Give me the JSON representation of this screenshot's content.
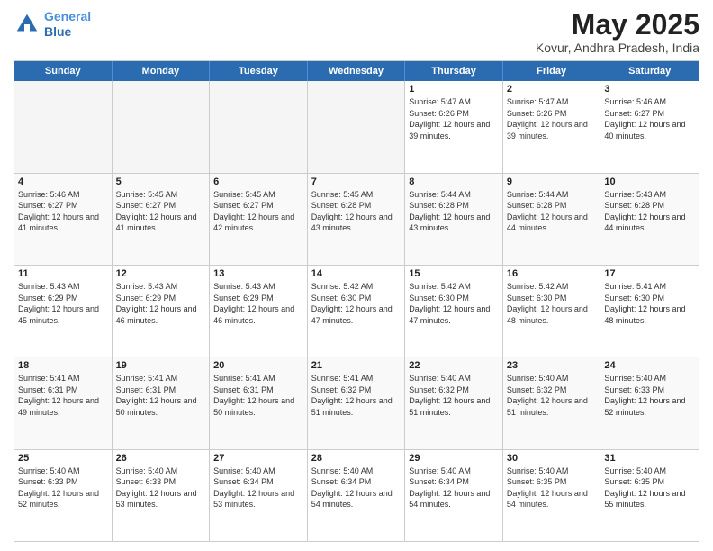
{
  "header": {
    "logo_line1": "General",
    "logo_line2": "Blue",
    "month": "May 2025",
    "location": "Kovur, Andhra Pradesh, India"
  },
  "weekdays": [
    "Sunday",
    "Monday",
    "Tuesday",
    "Wednesday",
    "Thursday",
    "Friday",
    "Saturday"
  ],
  "rows": [
    [
      {
        "day": "",
        "info": "",
        "empty": true
      },
      {
        "day": "",
        "info": "",
        "empty": true
      },
      {
        "day": "",
        "info": "",
        "empty": true
      },
      {
        "day": "",
        "info": "",
        "empty": true
      },
      {
        "day": "1",
        "info": "Sunrise: 5:47 AM\nSunset: 6:26 PM\nDaylight: 12 hours and 39 minutes."
      },
      {
        "day": "2",
        "info": "Sunrise: 5:47 AM\nSunset: 6:26 PM\nDaylight: 12 hours and 39 minutes."
      },
      {
        "day": "3",
        "info": "Sunrise: 5:46 AM\nSunset: 6:27 PM\nDaylight: 12 hours and 40 minutes."
      }
    ],
    [
      {
        "day": "4",
        "info": "Sunrise: 5:46 AM\nSunset: 6:27 PM\nDaylight: 12 hours and 41 minutes."
      },
      {
        "day": "5",
        "info": "Sunrise: 5:45 AM\nSunset: 6:27 PM\nDaylight: 12 hours and 41 minutes."
      },
      {
        "day": "6",
        "info": "Sunrise: 5:45 AM\nSunset: 6:27 PM\nDaylight: 12 hours and 42 minutes."
      },
      {
        "day": "7",
        "info": "Sunrise: 5:45 AM\nSunset: 6:28 PM\nDaylight: 12 hours and 43 minutes."
      },
      {
        "day": "8",
        "info": "Sunrise: 5:44 AM\nSunset: 6:28 PM\nDaylight: 12 hours and 43 minutes."
      },
      {
        "day": "9",
        "info": "Sunrise: 5:44 AM\nSunset: 6:28 PM\nDaylight: 12 hours and 44 minutes."
      },
      {
        "day": "10",
        "info": "Sunrise: 5:43 AM\nSunset: 6:28 PM\nDaylight: 12 hours and 44 minutes."
      }
    ],
    [
      {
        "day": "11",
        "info": "Sunrise: 5:43 AM\nSunset: 6:29 PM\nDaylight: 12 hours and 45 minutes."
      },
      {
        "day": "12",
        "info": "Sunrise: 5:43 AM\nSunset: 6:29 PM\nDaylight: 12 hours and 46 minutes."
      },
      {
        "day": "13",
        "info": "Sunrise: 5:43 AM\nSunset: 6:29 PM\nDaylight: 12 hours and 46 minutes."
      },
      {
        "day": "14",
        "info": "Sunrise: 5:42 AM\nSunset: 6:30 PM\nDaylight: 12 hours and 47 minutes."
      },
      {
        "day": "15",
        "info": "Sunrise: 5:42 AM\nSunset: 6:30 PM\nDaylight: 12 hours and 47 minutes."
      },
      {
        "day": "16",
        "info": "Sunrise: 5:42 AM\nSunset: 6:30 PM\nDaylight: 12 hours and 48 minutes."
      },
      {
        "day": "17",
        "info": "Sunrise: 5:41 AM\nSunset: 6:30 PM\nDaylight: 12 hours and 48 minutes."
      }
    ],
    [
      {
        "day": "18",
        "info": "Sunrise: 5:41 AM\nSunset: 6:31 PM\nDaylight: 12 hours and 49 minutes."
      },
      {
        "day": "19",
        "info": "Sunrise: 5:41 AM\nSunset: 6:31 PM\nDaylight: 12 hours and 50 minutes."
      },
      {
        "day": "20",
        "info": "Sunrise: 5:41 AM\nSunset: 6:31 PM\nDaylight: 12 hours and 50 minutes."
      },
      {
        "day": "21",
        "info": "Sunrise: 5:41 AM\nSunset: 6:32 PM\nDaylight: 12 hours and 51 minutes."
      },
      {
        "day": "22",
        "info": "Sunrise: 5:40 AM\nSunset: 6:32 PM\nDaylight: 12 hours and 51 minutes."
      },
      {
        "day": "23",
        "info": "Sunrise: 5:40 AM\nSunset: 6:32 PM\nDaylight: 12 hours and 51 minutes."
      },
      {
        "day": "24",
        "info": "Sunrise: 5:40 AM\nSunset: 6:33 PM\nDaylight: 12 hours and 52 minutes."
      }
    ],
    [
      {
        "day": "25",
        "info": "Sunrise: 5:40 AM\nSunset: 6:33 PM\nDaylight: 12 hours and 52 minutes."
      },
      {
        "day": "26",
        "info": "Sunrise: 5:40 AM\nSunset: 6:33 PM\nDaylight: 12 hours and 53 minutes."
      },
      {
        "day": "27",
        "info": "Sunrise: 5:40 AM\nSunset: 6:34 PM\nDaylight: 12 hours and 53 minutes."
      },
      {
        "day": "28",
        "info": "Sunrise: 5:40 AM\nSunset: 6:34 PM\nDaylight: 12 hours and 54 minutes."
      },
      {
        "day": "29",
        "info": "Sunrise: 5:40 AM\nSunset: 6:34 PM\nDaylight: 12 hours and 54 minutes."
      },
      {
        "day": "30",
        "info": "Sunrise: 5:40 AM\nSunset: 6:35 PM\nDaylight: 12 hours and 54 minutes."
      },
      {
        "day": "31",
        "info": "Sunrise: 5:40 AM\nSunset: 6:35 PM\nDaylight: 12 hours and 55 minutes."
      }
    ]
  ]
}
